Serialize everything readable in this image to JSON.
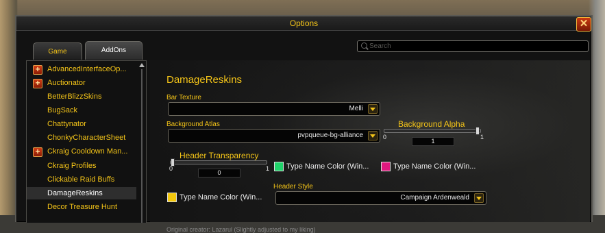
{
  "window": {
    "title": "Options"
  },
  "tabs": [
    {
      "label": "Game",
      "active": false
    },
    {
      "label": "AddOns",
      "active": true
    }
  ],
  "search": {
    "placeholder": "Search",
    "value": ""
  },
  "sidebar": {
    "items": [
      {
        "label": "AdvancedInterfaceOp...",
        "expandable": true,
        "selected": false
      },
      {
        "label": "Auctionator",
        "expandable": true,
        "selected": false
      },
      {
        "label": "BetterBlizzSkins",
        "expandable": false,
        "selected": false
      },
      {
        "label": "BugSack",
        "expandable": false,
        "selected": false
      },
      {
        "label": "Chattynator",
        "expandable": false,
        "selected": false
      },
      {
        "label": "ChonkyCharacterSheet",
        "expandable": false,
        "selected": false
      },
      {
        "label": "Ckraig Cooldown Man...",
        "expandable": true,
        "selected": false
      },
      {
        "label": "Ckraig Profiles",
        "expandable": false,
        "selected": false
      },
      {
        "label": "Clickable Raid Buffs",
        "expandable": false,
        "selected": false
      },
      {
        "label": "DamageReskins",
        "expandable": false,
        "selected": true
      },
      {
        "label": "Decor Treasure Hunt",
        "expandable": false,
        "selected": false
      }
    ]
  },
  "panel": {
    "title": "DamageReskins",
    "bar_texture": {
      "label": "Bar Texture",
      "value": "Melli"
    },
    "background_atlas": {
      "label": "Background Atlas",
      "value": "pvpqueue-bg-alliance"
    },
    "background_alpha": {
      "label": "Background Alpha",
      "min": "0",
      "max": "1",
      "value": "1",
      "fraction": 1.0
    },
    "header_transparency": {
      "label": "Header Transparency",
      "min": "0",
      "max": "1",
      "value": "0",
      "fraction": 0.0
    },
    "color_pickers": [
      {
        "label": "Type Name Color (Win...",
        "color": "#20d36a"
      },
      {
        "label": "Type Name Color (Win...",
        "color": "#e0187f"
      },
      {
        "label": "Type Name Color (Win...",
        "color": "#f3c70c"
      }
    ],
    "header_style": {
      "label": "Header Style",
      "value": "Campaign Ardenweald"
    },
    "footer": "Original creator: Lazarul (Slightly adjusted to my liking)"
  },
  "colors": {
    "accent": "#f5c518",
    "close_button": "#c93a10"
  }
}
